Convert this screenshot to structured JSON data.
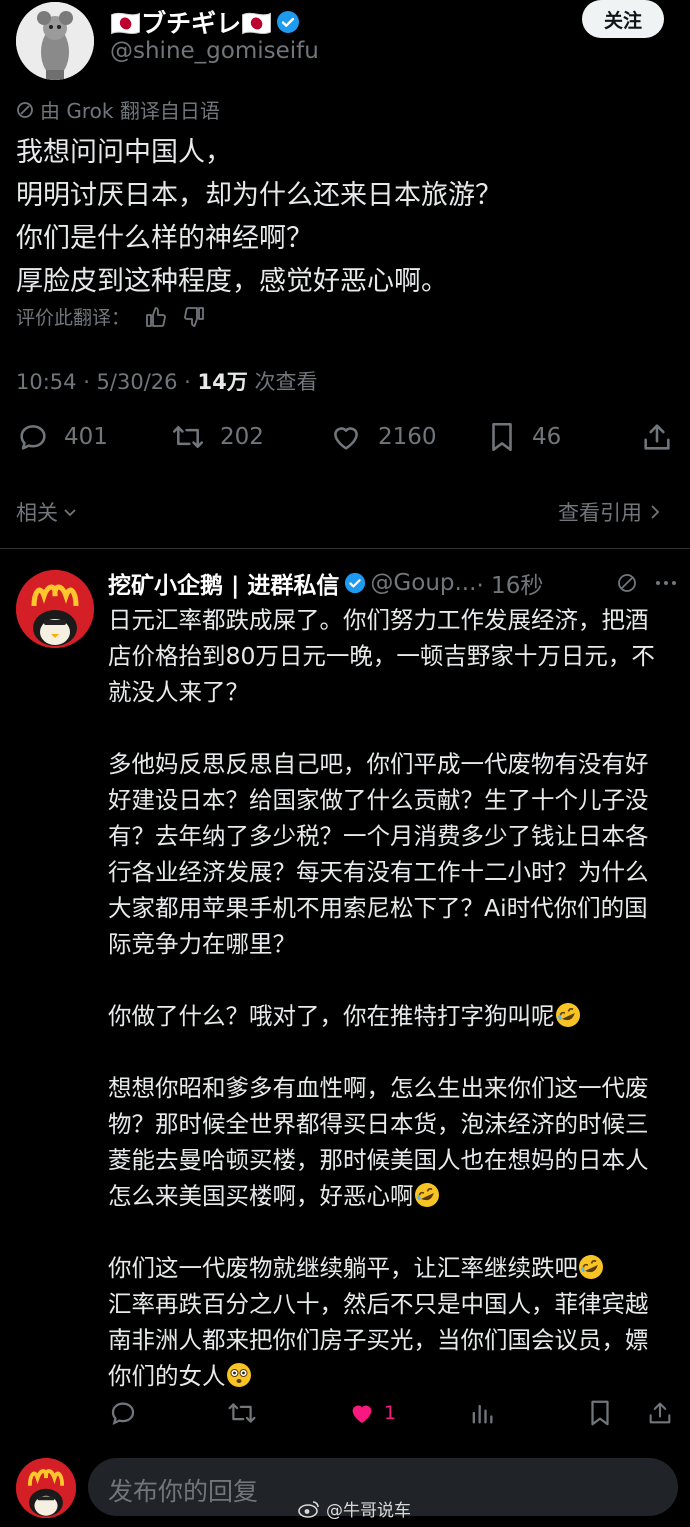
{
  "post": {
    "display_name": "🇯🇵ブチギレ🇯🇵",
    "handle": "@shine_gomiseifu",
    "follow_label": "关注",
    "translated_note": "由 Grok 翻译自日语",
    "text": "我想问问中国人，\n明明讨厌日本，却为什么还来日本旅游？\n你们是什么样的神经啊？\n厚脸皮到这种程度，感觉好恶心啊。",
    "rate_label": "评价此翻译：",
    "time_date": "10:54 · 5/30/26 · ",
    "views_count": "14万",
    "views_label": " 次查看",
    "actions": {
      "replies": "401",
      "retweets": "202",
      "likes": "2160",
      "bookmarks": "46"
    },
    "related_label": "相关",
    "quotes_label": "查看引用"
  },
  "reply": {
    "name": "挖矿小企鹅 | 进群私信",
    "handle": "@Goup...",
    "time": "· 16秒",
    "paragraphs": [
      "日元汇率都跌成屎了。你们努力工作发展经济，把酒店价格抬到80万日元一晚，一顿吉野家十万日元，不就没人来了？",
      "多他妈反思反思自己吧，你们平成一代废物有没有好好建设日本？给国家做了什么贡献？生了十个儿子没有？去年纳了多少税？一个月消费多少了钱让日本各行各业经济发展？每天有没有工作十二小时？为什么大家都用苹果手机不用索尼松下了？Ai时代你们的国际竞争力在哪里？",
      "你做了什么？哦对了，你在推特打字狗叫呢",
      "想想你昭和爹多有血性啊，怎么生出来你们这一代废物？那时候全世界都得买日本货，泡沫经济的时候三菱能去曼哈顿买楼，那时候美国人也在想妈的日本人怎么来美国买楼啊，好恶心啊",
      "你们这一代废物就继续躺平，让汇率继续跌吧",
      "汇率再跌百分之八十，然后不只是中国人，菲律宾越南非洲人都来把你们房子买光，当你们国会议员，嫖你们的女人"
    ],
    "like_count": "1"
  },
  "compose": {
    "placeholder": "发布你的回复"
  },
  "watermark": "@牛哥说车",
  "colors": {
    "background": "#000000",
    "text": "#e7e9ea",
    "muted": "#71767b",
    "verified": "#1d9bf0",
    "like": "#f91880"
  }
}
